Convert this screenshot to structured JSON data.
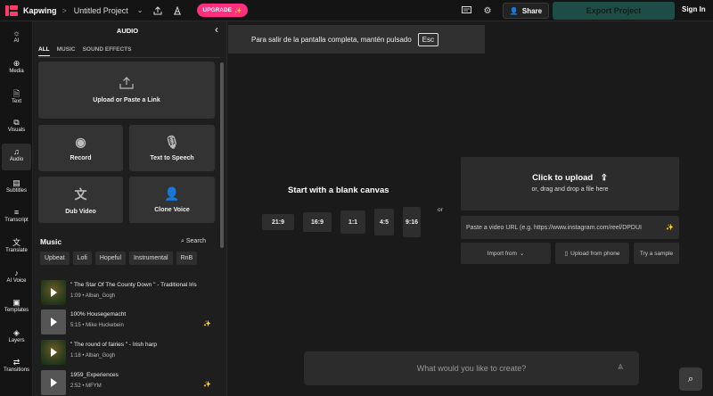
{
  "topbar": {
    "brand": "Kapwing",
    "separator": ">",
    "project_name": "Untitled Project",
    "upgrade_label": "UPGRADE",
    "share_label": "Share",
    "export_label": "Export Project",
    "signin_label": "Sign In"
  },
  "nav": {
    "items": [
      {
        "label": "AI",
        "icon": "lightbulb-icon"
      },
      {
        "label": "Media",
        "icon": "plus-circle-icon"
      },
      {
        "label": "Text",
        "icon": "text-icon"
      },
      {
        "label": "Visuals",
        "icon": "visuals-icon"
      },
      {
        "label": "Audio",
        "icon": "music-note-icon"
      },
      {
        "label": "Subtitles",
        "icon": "subtitles-icon"
      },
      {
        "label": "Transcript",
        "icon": "transcript-icon"
      },
      {
        "label": "Translate",
        "icon": "translate-icon"
      },
      {
        "label": "AI Voice",
        "icon": "ai-voice-icon"
      },
      {
        "label": "Templates",
        "icon": "templates-icon"
      },
      {
        "label": "Layers",
        "icon": "layers-icon"
      },
      {
        "label": "Transitions",
        "icon": "transitions-icon"
      }
    ],
    "active": "Audio"
  },
  "panel": {
    "title": "AUDIO",
    "tabs": [
      "ALL",
      "MUSIC",
      "SOUND EFFECTS"
    ],
    "upload_label": "Upload or Paste a Link",
    "cards": [
      "Record",
      "Text to Speech",
      "Dub Video",
      "Clone Voice"
    ],
    "music_heading": "Music",
    "search_label": "Search",
    "chips": [
      "Upbeat",
      "Lofi",
      "Hopeful",
      "Instrumental",
      "RnB"
    ],
    "tracks": [
      {
        "title": "\" The Star Of The County Down \" - Traditional Iris",
        "meta": "1:09 • Alban_Gogh"
      },
      {
        "title": "100% Housegemacht",
        "meta": "5:15 • Mike Huckebein"
      },
      {
        "title": "\" The round of fairies \" - Irish harp",
        "meta": "1:18 • Alban_Gogh"
      },
      {
        "title": "1959_Experiences",
        "meta": "2:52 • MFYM"
      }
    ]
  },
  "stage": {
    "fullscreen_notice": "Para salir de la pantalla completa, mantén pulsado",
    "esc_key": "Esc",
    "blank_canvas_title": "Start with a blank canvas",
    "ratios": [
      "21:9",
      "16:9",
      "1:1",
      "4:5",
      "9:16"
    ],
    "or_label": "or",
    "upload_title": "Click to upload",
    "upload_sub": "or, drag and drop a file here",
    "url_placeholder": "Paste a video URL (e.g. https://www.instagram.com/reel/DPDUI",
    "import_label": "Import from",
    "phone_label": "Upload from phone",
    "sample_label": "Try a sample",
    "prompt_placeholder": "What would you like to create?"
  }
}
